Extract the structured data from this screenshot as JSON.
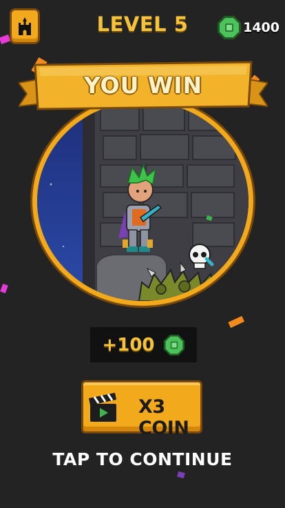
{
  "header": {
    "level_label": "LEVEL 5",
    "gem_count": "1400",
    "home_icon": "castle-icon",
    "gem_icon": "green-gem-icon"
  },
  "banner": {
    "title": "YOU WIN"
  },
  "reward": {
    "amount": "+100",
    "icon": "green-gem-icon"
  },
  "multiplier_button": {
    "label": "X3 COIN",
    "icon": "clapperboard-video-icon"
  },
  "continue_prompt": "TAP TO CONTINUE",
  "colors": {
    "background": "#232323",
    "gold": "#f2a91c",
    "gold_text": "#f5c23b",
    "gem_green": "#3fb34f"
  }
}
